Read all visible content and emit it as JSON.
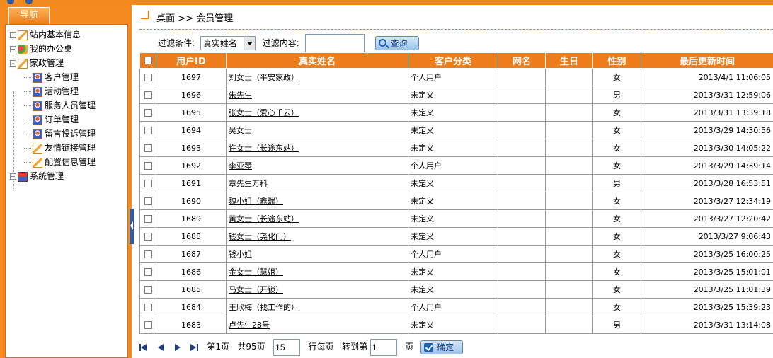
{
  "sidebar": {
    "nav_title": "导航",
    "tree": [
      {
        "label": "站内基本信息",
        "toggle": "+",
        "icon": "pen-icon",
        "level": 0
      },
      {
        "label": "我的办公桌",
        "toggle": "+",
        "icon": "leaf-icon",
        "level": 0
      },
      {
        "label": "家政管理",
        "toggle": "-",
        "icon": "pen-icon",
        "level": 0
      },
      {
        "label": "客户管理",
        "icon": "user-folder-icon",
        "level": 1
      },
      {
        "label": "活动管理",
        "icon": "user-folder-icon",
        "level": 1
      },
      {
        "label": "服务人员管理",
        "icon": "user-folder-icon",
        "level": 1
      },
      {
        "label": "订单管理",
        "icon": "user-folder-icon",
        "level": 1
      },
      {
        "label": "留言投诉管理",
        "icon": "user-folder-icon",
        "level": 1
      },
      {
        "label": "友情链接管理",
        "icon": "pen-icon",
        "level": 1
      },
      {
        "label": "配置信息管理",
        "icon": "pen-icon",
        "level": 1
      },
      {
        "label": "系统管理",
        "toggle": "+",
        "icon": "system-icon",
        "level": 0
      }
    ]
  },
  "breadcrumb": {
    "home": "桌面",
    "sep": ">>",
    "current": "会员管理"
  },
  "filter": {
    "condition_label": "过滤条件:",
    "condition_value": "真实姓名",
    "content_label": "过滤内容:",
    "content_value": "",
    "query_label": "查询"
  },
  "table": {
    "columns": [
      "用户ID",
      "真实姓名",
      "客户分类",
      "网名",
      "生日",
      "性别",
      "最后更新时间"
    ],
    "rows": [
      {
        "id": "1697",
        "name": "刘女士（平安家政）",
        "category": "个人用户",
        "nickname": "",
        "birthday": "",
        "gender": "女",
        "updated": "2013/4/1 11:06:05"
      },
      {
        "id": "1696",
        "name": "朱先生",
        "category": "未定义",
        "nickname": "",
        "birthday": "",
        "gender": "男",
        "updated": "2013/3/31 12:59:06"
      },
      {
        "id": "1695",
        "name": "张女士（爱心千云）",
        "category": "未定义",
        "nickname": "",
        "birthday": "",
        "gender": "女",
        "updated": "2013/3/31 13:39:18"
      },
      {
        "id": "1694",
        "name": "吴女士",
        "category": "未定义",
        "nickname": "",
        "birthday": "",
        "gender": "女",
        "updated": "2013/3/29 14:30:56"
      },
      {
        "id": "1693",
        "name": "许女士（长途东站）",
        "category": "未定义",
        "nickname": "",
        "birthday": "",
        "gender": "女",
        "updated": "2013/3/30 14:05:22"
      },
      {
        "id": "1692",
        "name": "李亚琴",
        "category": "个人用户",
        "nickname": "",
        "birthday": "",
        "gender": "女",
        "updated": "2013/3/29 14:39:14"
      },
      {
        "id": "1691",
        "name": "章先生万科",
        "category": "未定义",
        "nickname": "",
        "birthday": "",
        "gender": "男",
        "updated": "2013/3/28 16:53:51"
      },
      {
        "id": "1690",
        "name": "魏小姐（鑫瑞）",
        "category": "未定义",
        "nickname": "",
        "birthday": "",
        "gender": "女",
        "updated": "2013/3/27 12:34:19"
      },
      {
        "id": "1689",
        "name": "黄女士（长途东站）",
        "category": "未定义",
        "nickname": "",
        "birthday": "",
        "gender": "女",
        "updated": "2013/3/27 12:20:42"
      },
      {
        "id": "1688",
        "name": "钱女士（尧化门）",
        "category": "未定义",
        "nickname": "",
        "birthday": "",
        "gender": "女",
        "updated": "2013/3/27 9:06:43"
      },
      {
        "id": "1687",
        "name": "钱小姐",
        "category": "个人用户",
        "nickname": "",
        "birthday": "",
        "gender": "女",
        "updated": "2013/3/25 16:00:25"
      },
      {
        "id": "1686",
        "name": "金女士（慧姐）",
        "category": "未定义",
        "nickname": "",
        "birthday": "",
        "gender": "女",
        "updated": "2013/3/25 15:01:01"
      },
      {
        "id": "1685",
        "name": "马女士（开锁）",
        "category": "未定义",
        "nickname": "",
        "birthday": "",
        "gender": "女",
        "updated": "2013/3/25 11:01:39"
      },
      {
        "id": "1684",
        "name": "王欣梅（找工作的）",
        "category": "个人用户",
        "nickname": "",
        "birthday": "",
        "gender": "女",
        "updated": "2013/3/25 15:39:23"
      },
      {
        "id": "1683",
        "name": "卢先生28号",
        "category": "未定义",
        "nickname": "",
        "birthday": "",
        "gender": "男",
        "updated": "2013/3/31 13:14:08"
      }
    ]
  },
  "pager": {
    "page_text": "第1页",
    "total_text": "共95页",
    "per_page_value": "15",
    "per_page_label": "行每页",
    "goto_label": "转到第",
    "goto_value": "1",
    "page_suffix": "页",
    "confirm_label": "确定"
  },
  "colors": {
    "accent": "#ed7c1a",
    "sidebar": "#f58a1e",
    "button": "#9fc3ea"
  }
}
